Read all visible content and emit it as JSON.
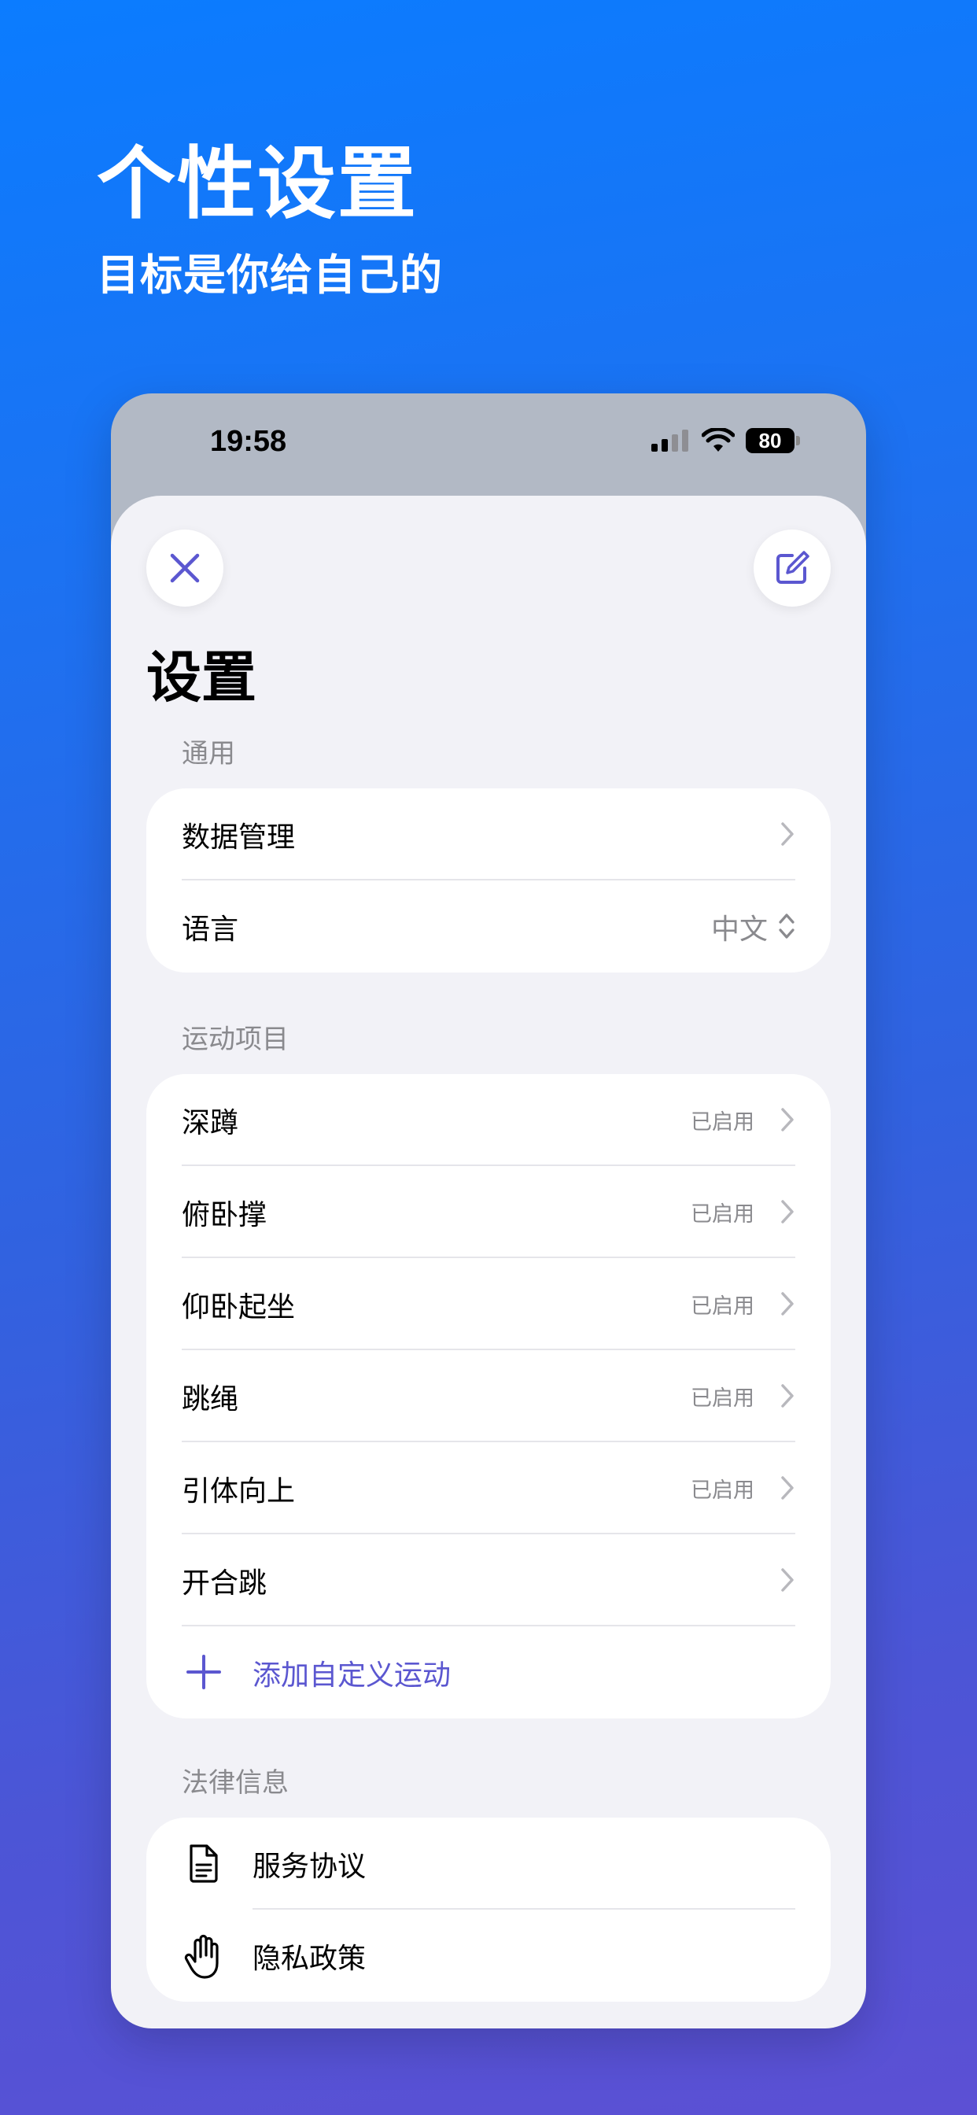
{
  "promo": {
    "title": "个性设置",
    "subtitle": "目标是你给自己的"
  },
  "status_bar": {
    "time": "19:58",
    "battery": "80"
  },
  "sheet": {
    "title": "设置"
  },
  "sections": {
    "general": {
      "label": "通用",
      "rows": {
        "data_management": "数据管理",
        "language": "语言",
        "language_value": "中文"
      }
    },
    "exercises": {
      "label": "运动项目",
      "rows": [
        {
          "label": "深蹲",
          "status": "已启用"
        },
        {
          "label": "俯卧撑",
          "status": "已启用"
        },
        {
          "label": "仰卧起坐",
          "status": "已启用"
        },
        {
          "label": "跳绳",
          "status": "已启用"
        },
        {
          "label": "引体向上",
          "status": "已启用"
        },
        {
          "label": "开合跳",
          "status": ""
        }
      ],
      "add_label": "添加自定义运动"
    },
    "legal": {
      "label": "法律信息",
      "rows": {
        "terms": "服务协议",
        "privacy": "隐私政策"
      }
    }
  },
  "colors": {
    "accent": "#5b57d0",
    "background_top": "#0b7cff",
    "background_bottom": "#5c50d4",
    "sheet": "#f2f2f7"
  },
  "icons": [
    "close-icon",
    "edit-icon",
    "chevron-right-icon",
    "chevron-up-down-icon",
    "plus-icon",
    "document-icon",
    "hand-icon",
    "signal-icon",
    "wifi-icon",
    "battery-icon"
  ]
}
